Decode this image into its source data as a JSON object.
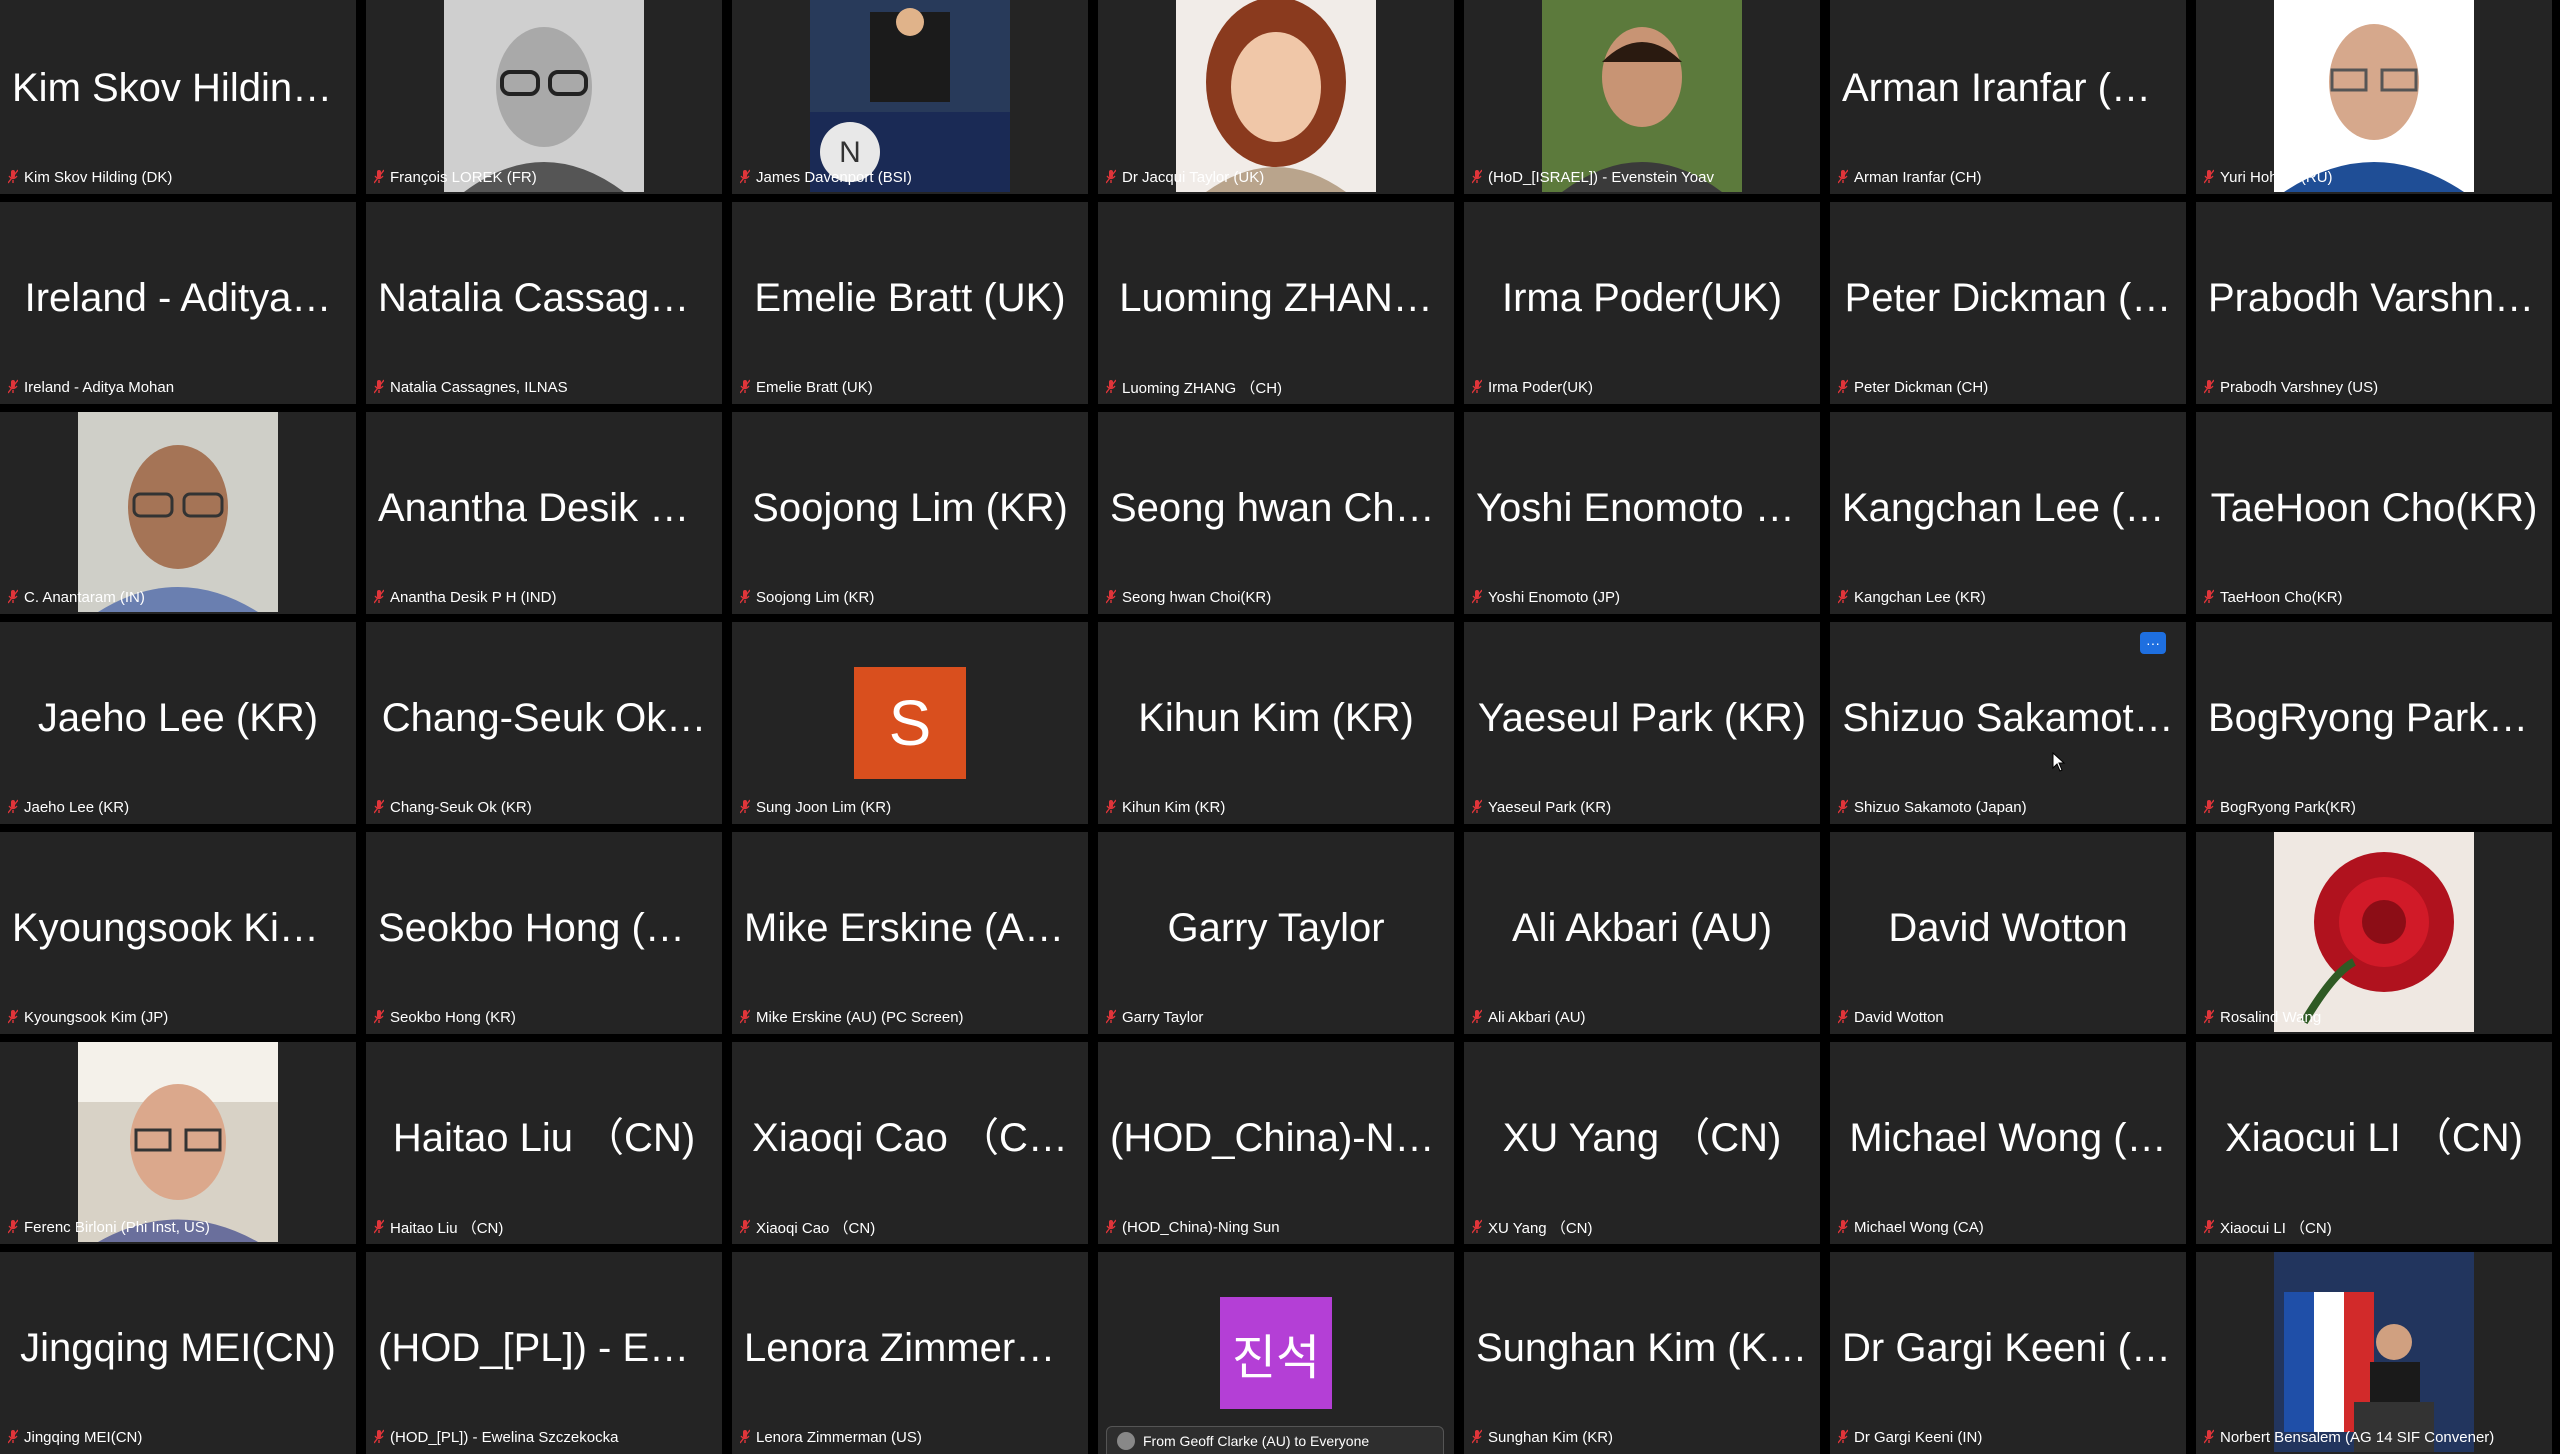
{
  "participants": [
    {
      "display": "Kim Skov Hilding…",
      "label": "Kim Skov Hilding (DK)"
    },
    {
      "display": "",
      "label": "François LOREK (FR)",
      "photo": "portrait-glasses-gray"
    },
    {
      "display": "",
      "label": "James Davenport (BSI)",
      "photo": "graduation-gown-podium"
    },
    {
      "display": "",
      "label": "Dr Jacqui Taylor (UK)",
      "photo": "portrait-smiling-woman"
    },
    {
      "display": "",
      "label": "(HoD_[ISRAEL]) - Evenstein Yoav",
      "photo": "portrait-man-trees"
    },
    {
      "display": "Arman Iranfar (C…",
      "label": "Arman Iranfar (CH)"
    },
    {
      "display": "",
      "label": "Yuri Hohlov (RU)",
      "photo": "portrait-man-glasses-blue"
    },
    {
      "display": "Ireland - Aditya…",
      "label": "Ireland - Aditya Mohan"
    },
    {
      "display": "Natalia Cassagn…",
      "label": "Natalia Cassagnes, ILNAS"
    },
    {
      "display": "Emelie Bratt (UK)",
      "label": "Emelie Bratt (UK)"
    },
    {
      "display": "Luoming ZHAN…",
      "label": "Luoming ZHANG （CH)"
    },
    {
      "display": "Irma Poder(UK)",
      "label": "Irma Poder(UK)"
    },
    {
      "display": "Peter Dickman (…",
      "label": "Peter Dickman (CH)"
    },
    {
      "display": "Prabodh Varshne…",
      "label": "Prabodh Varshney (US)"
    },
    {
      "display": "",
      "label": "C. Anantaram (IN)",
      "photo": "portrait-man-glasses-webcam"
    },
    {
      "display": "Anantha Desik P…",
      "label": "Anantha Desik P H (IND)"
    },
    {
      "display": "Soojong Lim (KR)",
      "label": "Soojong Lim (KR)"
    },
    {
      "display": "Seong hwan Cho…",
      "label": "Seong hwan Choi(KR)"
    },
    {
      "display": "Yoshi Enomoto (…",
      "label": "Yoshi Enomoto (JP)"
    },
    {
      "display": "Kangchan Lee (K…",
      "label": "Kangchan Lee (KR)"
    },
    {
      "display": "TaeHoon Cho(KR)",
      "label": "TaeHoon Cho(KR)"
    },
    {
      "display": "Jaeho Lee (KR)",
      "label": "Jaeho Lee (KR)"
    },
    {
      "display": "Chang-Seuk Ok…",
      "label": "Chang-Seuk Ok (KR)"
    },
    {
      "display": "",
      "label": "Sung Joon Lim (KR)",
      "avatar": "S",
      "avatar_color": "#d94f1e"
    },
    {
      "display": "Kihun Kim (KR)",
      "label": "Kihun Kim (KR)"
    },
    {
      "display": "Yaeseul Park (KR)",
      "label": "Yaeseul Park (KR)"
    },
    {
      "display": "Shizuo Sakamot…",
      "label": "Shizuo Sakamoto (Japan)",
      "more": "···"
    },
    {
      "display": "BogRyong Park(…",
      "label": "BogRyong Park(KR)"
    },
    {
      "display": "Kyoungsook Kim…",
      "label": "Kyoungsook Kim (JP)"
    },
    {
      "display": "Seokbo Hong (KR)",
      "label": "Seokbo Hong (KR)"
    },
    {
      "display": "Mike Erskine (AU…",
      "label": "Mike Erskine (AU)  (PC Screen)"
    },
    {
      "display": "Garry Taylor",
      "label": "Garry Taylor"
    },
    {
      "display": "Ali Akbari (AU)",
      "label": "Ali Akbari (AU)"
    },
    {
      "display": "David Wotton",
      "label": "David Wotton"
    },
    {
      "display": "",
      "label": "Rosalind Wang",
      "photo": "red-rose"
    },
    {
      "display": "",
      "label": "Ferenc Birloni (Phi Inst, US)",
      "photo": "portrait-man-glasses-office"
    },
    {
      "display": "Haitao Liu （CN)",
      "label": "Haitao Liu （CN)"
    },
    {
      "display": "Xiaoqi Cao （C…",
      "label": "Xiaoqi Cao （CN)"
    },
    {
      "display": "(HOD_China)-Ni…",
      "label": "(HOD_China)-Ning Sun"
    },
    {
      "display": "XU Yang （CN)",
      "label": "XU Yang （CN)"
    },
    {
      "display": "Michael Wong (…",
      "label": "Michael Wong (CA)"
    },
    {
      "display": "Xiaocui LI （CN)",
      "label": "Xiaocui LI （CN)"
    },
    {
      "display": "Jingqing MEI(CN)",
      "label": "Jingqing MEI(CN)"
    },
    {
      "display": "(HOD_[PL]) - Ew…",
      "label": "(HOD_[PL]) - Ewelina Szczekocka"
    },
    {
      "display": "Lenora Zimmerm…",
      "label": "Lenora Zimmerman (US)"
    },
    {
      "display": "",
      "label": "",
      "avatar": "진석",
      "avatar_color": "#b43fd6",
      "chat": "From Geoff Clarke (AU) to Everyone"
    },
    {
      "display": "Sunghan Kim (KR)",
      "label": "Sunghan Kim (KR)"
    },
    {
      "display": "Dr Gargi Keeni (I…",
      "label": "Dr Gargi Keeni (IN)"
    },
    {
      "display": "",
      "label": "Norbert Bensalem (AG 14 SIF Convener)",
      "photo": "man-at-podium-flags"
    }
  ],
  "colors": {
    "tile": "#242424",
    "mic_muted": "#e0353a",
    "accent": "#1e6fe0"
  }
}
